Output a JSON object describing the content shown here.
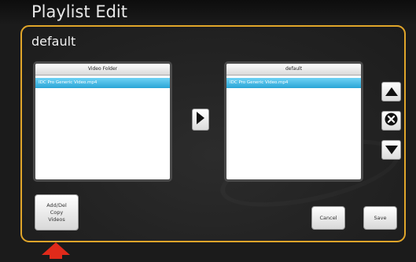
{
  "header": {
    "title": "Playlist Edit"
  },
  "playlist": {
    "name": "default"
  },
  "source_list": {
    "header": "Video Folder",
    "items": [
      "IDC Pro Generic Video.mp4"
    ]
  },
  "target_list": {
    "header": "default",
    "items": [
      "IDC Pro Generic Video.mp4"
    ]
  },
  "buttons": {
    "add_copy": "Add/Del\nCopy\nVideos",
    "cancel": "Cancel",
    "save": "Save"
  },
  "icons": {
    "add": "play-right-icon",
    "move_up": "triangle-up-icon",
    "remove": "x-circle-icon",
    "move_down": "triangle-down-icon",
    "annotation": "red-arrow-up-icon"
  },
  "colors": {
    "accent": "#e0a52a",
    "selection": "#2aa5d6",
    "annotation": "#e02a1a"
  }
}
